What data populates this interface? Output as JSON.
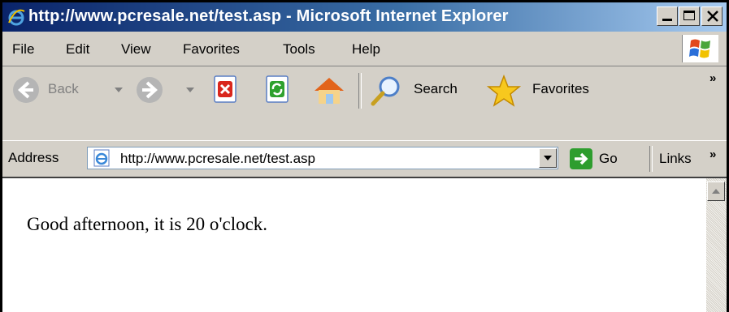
{
  "window": {
    "title": "http://www.pcresale.net/test.asp - Microsoft Internet Explorer"
  },
  "menubar": {
    "items": [
      "File",
      "Edit",
      "View",
      "Favorites",
      "Tools",
      "Help"
    ]
  },
  "toolbar": {
    "back_label": "Back",
    "search_label": "Search",
    "favorites_label": "Favorites",
    "more_chevron": "»"
  },
  "addressbar": {
    "label": "Address",
    "url": "http://www.pcresale.net/test.asp",
    "go_label": "Go",
    "links_label": "Links",
    "links_chevron": "»"
  },
  "content": {
    "text": "Good afternoon, it is 20 o'clock."
  }
}
